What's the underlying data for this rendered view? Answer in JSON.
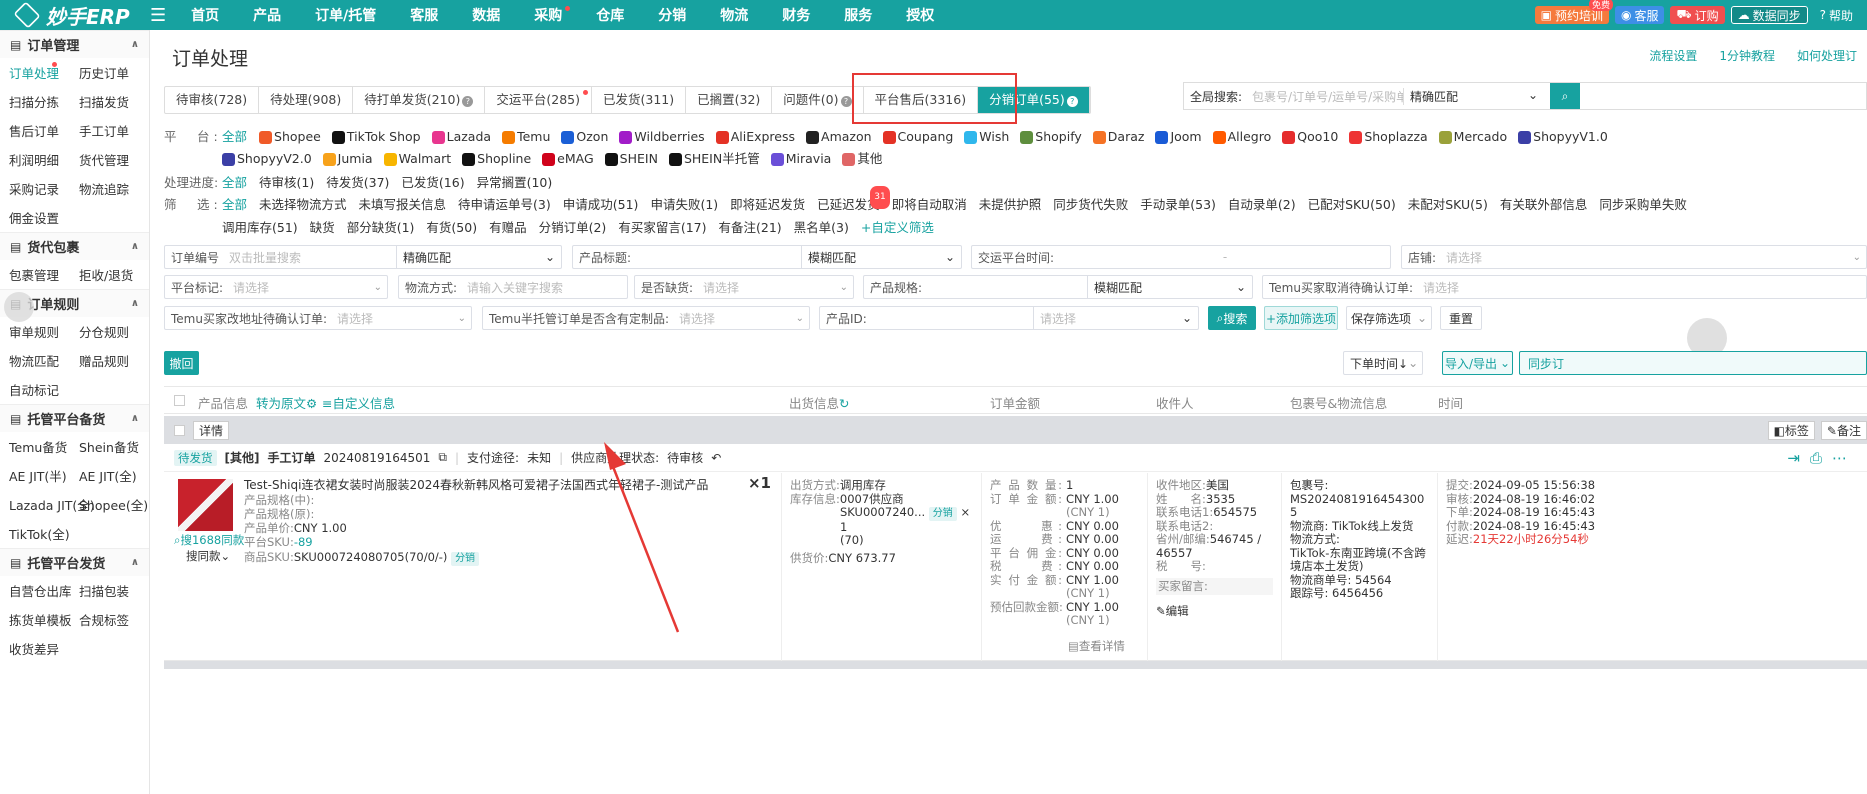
{
  "app": {
    "name": "妙手ERP"
  },
  "nav": [
    {
      "label": "首页"
    },
    {
      "label": "产品"
    },
    {
      "label": "订单/托管"
    },
    {
      "label": "客服"
    },
    {
      "label": "数据"
    },
    {
      "label": "采购",
      "dot": true
    },
    {
      "label": "仓库"
    },
    {
      "label": "分销"
    },
    {
      "label": "物流"
    },
    {
      "label": "财务"
    },
    {
      "label": "服务"
    },
    {
      "label": "授权"
    }
  ],
  "topright": {
    "training": "预约培训",
    "free_tag": "免费",
    "service": "客服",
    "subscribe": "订购",
    "sync": "数据同步",
    "help": "帮助"
  },
  "sidebar": [
    {
      "title": "订单管理",
      "rows": [
        [
          "订单处理",
          "历史订单"
        ],
        [
          "扫描分拣",
          "扫描发货"
        ],
        [
          "售后订单",
          "手工订单"
        ],
        [
          "利润明细",
          "货代管理"
        ],
        [
          "采购记录",
          "物流追踪"
        ],
        [
          "佣金设置",
          ""
        ]
      ]
    },
    {
      "title": "货代包裹",
      "rows": [
        [
          "包裹管理",
          "拒收/退货"
        ]
      ]
    },
    {
      "title": "订单规则",
      "rows": [
        [
          "审单规则",
          "分仓规则"
        ],
        [
          "物流匹配",
          "赠品规则"
        ],
        [
          "自动标记",
          ""
        ]
      ]
    },
    {
      "title": "托管平台备货",
      "rows": [
        [
          "Temu备货",
          "Shein备货"
        ],
        [
          "AE JIT(半)",
          "AE JIT(全)"
        ],
        [
          "Lazada JIT(全)",
          "Shopee(全)"
        ],
        [
          "TikTok(全)",
          ""
        ]
      ]
    },
    {
      "title": "托管平台发货",
      "rows": [
        [
          "自营仓出库",
          "扫描包装"
        ],
        [
          "拣货单模板",
          "合规标签"
        ],
        [
          "收货差异",
          ""
        ]
      ]
    }
  ],
  "page": {
    "title": "订单处理",
    "links": [
      "流程设置",
      "1分钟教程",
      "如何处理订"
    ]
  },
  "tabs": [
    {
      "label": "待审核(728)"
    },
    {
      "label": "待处理(908)"
    },
    {
      "label": "待打单发货(210)",
      "q": true
    },
    {
      "label": "交运平台(285)",
      "dot": true
    },
    {
      "label": "已发货(311)"
    },
    {
      "label": "已搁置(32)"
    },
    {
      "label": "问题件(0)",
      "q": true
    },
    {
      "label": "平台售后(3316)"
    },
    {
      "label": "分销订单(55)",
      "q": true,
      "active": true
    }
  ],
  "gsearch": {
    "label": "全局搜索:",
    "placeholder": "包裹号/订单号/运单号/采购单号",
    "mode": "精确匹配"
  },
  "filters": {
    "platform_label": "平　台:",
    "all": "全部",
    "platforms": [
      {
        "name": "Shopee",
        "c": "#f05a28"
      },
      {
        "name": "TikTok Shop",
        "c": "#111"
      },
      {
        "name": "Lazada",
        "c": "#e8368f"
      },
      {
        "name": "Temu",
        "c": "#f57c00"
      },
      {
        "name": "Ozon",
        "c": "#1b5fd6"
      },
      {
        "name": "Wildberries",
        "c": "#a11cc8"
      },
      {
        "name": "AliExpress",
        "c": "#e43225"
      },
      {
        "name": "Amazon",
        "c": "#222"
      },
      {
        "name": "Coupang",
        "c": "#e43225"
      },
      {
        "name": "Wish",
        "c": "#2fb7ec"
      },
      {
        "name": "Shopify",
        "c": "#5e8e3e"
      },
      {
        "name": "Daraz",
        "c": "#f57224"
      },
      {
        "name": "Joom",
        "c": "#1a5bd6"
      },
      {
        "name": "Allegro",
        "c": "#ff5a00"
      },
      {
        "name": "Qoo10",
        "c": "#e52d2d"
      },
      {
        "name": "Shoplazza",
        "c": "#e33"
      },
      {
        "name": "Mercado",
        "c": "#9aa13a"
      },
      {
        "name": "ShopyyV1.0",
        "c": "#3b3fa6"
      },
      {
        "name": "ShopyyV2.0",
        "c": "#3b3fa6"
      },
      {
        "name": "Jumia",
        "c": "#f7a21b"
      },
      {
        "name": "Walmart",
        "c": "#f7b500"
      },
      {
        "name": "Shopline",
        "c": "#111"
      },
      {
        "name": "eMAG",
        "c": "#d0021b"
      },
      {
        "name": "SHEIN",
        "c": "#111"
      },
      {
        "name": "SHEIN半托管",
        "c": "#111"
      },
      {
        "name": "Miravia",
        "c": "#6b4fd8"
      },
      {
        "name": "其他",
        "c": "#e06666"
      }
    ],
    "progress_label": "处理进度:",
    "progress": [
      "全部",
      "待审核(1)",
      "待发货(37)",
      "已发货(16)",
      "异常搁置(10)"
    ],
    "screen_label": "筛　选:",
    "screens": [
      "全部",
      "未选择物流方式",
      "未填写报关信息",
      "待申请运单号(3)",
      "申请成功(51)",
      "申请失败(1)",
      "即将延迟发货",
      "已延迟发货",
      "即将自动取消",
      "未提供护照",
      "同步货代失败",
      "手动录单(53)",
      "自动录单(2)",
      "已配对SKU(50)",
      "未配对SKU(5)",
      "有关联外部信息",
      "同步采购单失败",
      "调用库存(51)",
      "缺货",
      "部分缺货(1)",
      "有货(50)",
      "有赠品",
      "分销订单(2)",
      "有买家留言(17)",
      "有备注(21)",
      "黑名单(3)",
      "+自定义筛选"
    ],
    "delayed_badge": "31"
  },
  "form": {
    "order_no": "订单编号",
    "batch_ph": "双击批量搜索",
    "fuzzy": "精确匹配",
    "title": "产品标题:",
    "fuzzy2": "模糊匹配",
    "ship_time": "交运平台时间:",
    "dash": "-",
    "store": "店铺:",
    "select_ph": "请选择",
    "mark": "平台标记:",
    "logistics": "物流方式:",
    "logistics_ph": "请输入关键字搜索",
    "stock": "是否缺货:",
    "spec": "产品规格:",
    "temu_cancel": "Temu买家取消待确认订单:",
    "temu_addr": "Temu买家改地址待确认订单:",
    "temu_custom": "Temu半托管订单是否含有定制品:",
    "pid": "产品ID:",
    "search": "搜索",
    "add_filter": "+添加筛选项",
    "save_filter": "保存筛选项",
    "reset": "重置"
  },
  "toolbar": {
    "undo": "撤回",
    "sort": "下单时间↓",
    "import": "导入/导出",
    "sync": "同步订"
  },
  "thead": {
    "product": "产品信息",
    "translate": "转为原文",
    "custom": "≡自定义信息",
    "ship": "出货信息",
    "amount": "订单金额",
    "recv": "收件人",
    "pkg": "包裹号&物流信息",
    "time": "时间"
  },
  "group": {
    "detail": "详情",
    "tag": "标签",
    "note": "备注"
  },
  "order": {
    "status": "待发货",
    "type": "[其他]",
    "manual": "手工订单",
    "no": "20240819164501",
    "pay_label": "支付途径:",
    "pay": "未知",
    "supplier_label": "供应商处理状态:",
    "supplier": "待审核",
    "title": "Test-Shiqi连衣裙女装时尚服装2024春秋新韩风格可爱裙子法国西式年轻裙子-测试产品",
    "qty": "×1",
    "spec_mid": "产品规格(中):",
    "spec_orig": "产品规格(原):",
    "price_label": "产品单价:",
    "price": "CNY 1.00",
    "sku_label": "平台SKU:",
    "sku": "-89",
    "psku_label": "商品SKU:",
    "psku": "SKU000724080705(70/0/-)",
    "fx": "分销",
    "s1688": "搜1688同款",
    "same": "搜同款",
    "ship_method_label": "出货方式:",
    "ship_method": "调用库存",
    "stock_label": "库存信息:",
    "stock1": "0007供应商",
    "stock2": "SKU0007240...",
    "stock3": "(70)",
    "supply_label": "供货价:",
    "supply": "CNY 673.77",
    "times1": "× 1",
    "amounts": [
      [
        "产 品 数 量:",
        "1",
        ""
      ],
      [
        "订 单 金 额:",
        "CNY 1.00",
        "(CNY 1)"
      ],
      [
        "优　　惠:",
        "CNY 0.00",
        ""
      ],
      [
        "运　　费:",
        "CNY 0.00",
        ""
      ],
      [
        "平 台 佣 金:",
        "CNY 0.00",
        ""
      ],
      [
        "税　　费:",
        "CNY 0.00",
        ""
      ],
      [
        "实 付 金 额:",
        "CNY 1.00",
        "(CNY 1)"
      ],
      [
        "预估回款金额:",
        "CNY 1.00",
        "(CNY 1)"
      ]
    ],
    "detail_link": "查看详情",
    "recv": [
      [
        "收件地区:",
        "美国"
      ],
      [
        "姓　　名:",
        "3535"
      ],
      [
        "联系电话1:",
        "654575"
      ],
      [
        "联系电话2:",
        ""
      ],
      [
        "省州/邮编:",
        "546745 / 46557"
      ],
      [
        "税　　号:",
        ""
      ]
    ],
    "buyer_msg": "买家留言:",
    "edit": "编辑",
    "pkg": [
      "包裹号:",
      "MS20240819164543005",
      "物流商: TikTok线上发货",
      "物流方式:",
      "TikTok-东南亚跨境(不含跨境店本土发货)",
      "物流商单号: 54564",
      "跟踪号: 6456456"
    ],
    "times": [
      [
        "提交:",
        "2024-09-05 15:56:38"
      ],
      [
        "审核:",
        "2024-08-19 16:46:02"
      ],
      [
        "下单:",
        "2024-08-19 16:45:43"
      ],
      [
        "付款:",
        "2024-08-19 16:45:43"
      ],
      [
        "延迟:",
        "21天22小时26分54秒"
      ]
    ]
  },
  "colors": {
    "accent": "#17a2a0",
    "danger": "#e53935"
  }
}
